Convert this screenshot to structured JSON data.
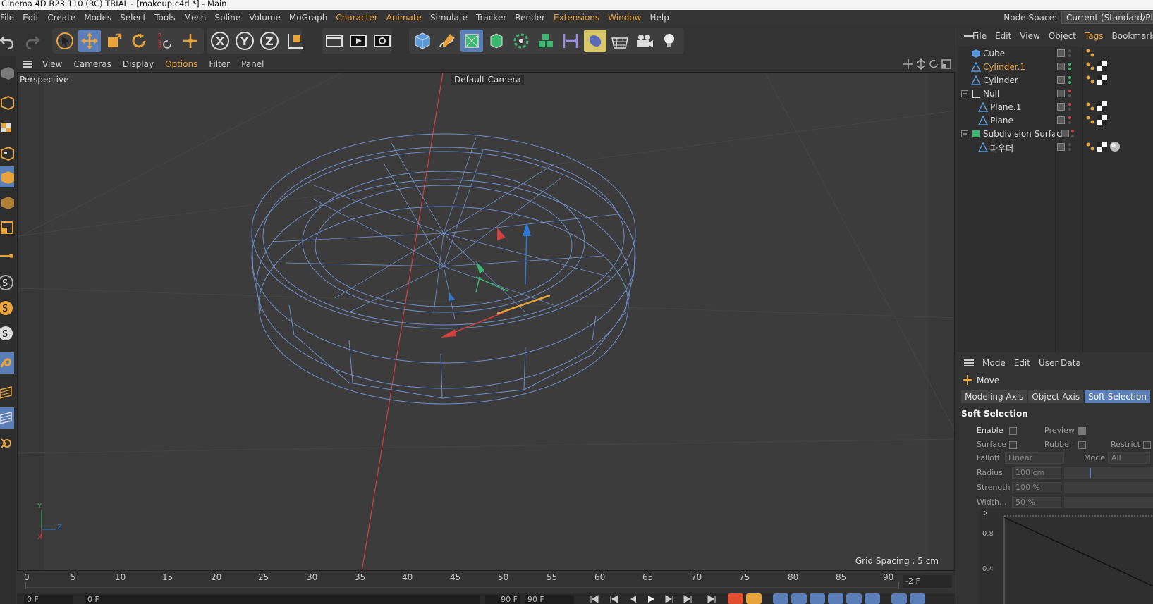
{
  "title": "Cinema 4D R23.110 (RC) TRIAL - [makeup.c4d *] - Main",
  "menu": [
    "File",
    "Edit",
    "Create",
    "Modes",
    "Select",
    "Tools",
    "Mesh",
    "Spline",
    "Volume",
    "MoGraph",
    "Character",
    "Animate",
    "Simulate",
    "Tracker",
    "Render",
    "Extensions",
    "Window",
    "Help"
  ],
  "node_space": {
    "label": "Node Space:",
    "value": "Current (Standard/Physical)"
  },
  "viewport": {
    "menu": [
      "View",
      "Cameras",
      "Display",
      "Options",
      "Filter",
      "Panel"
    ],
    "label": "Perspective",
    "camera": "Default Camera",
    "grid_spacing": "Grid Spacing : 5 cm",
    "axis_y": "Y",
    "axis_z": "Z",
    "axis_x": "X"
  },
  "timeline": {
    "ticks": [
      "0",
      "5",
      "10",
      "15",
      "20",
      "25",
      "30",
      "35",
      "40",
      "45",
      "50",
      "55",
      "60",
      "65",
      "70",
      "75",
      "80",
      "85",
      "90"
    ],
    "frame_end": "-2 F",
    "field_start": "0 F",
    "field_current": "0 F",
    "field_max": "90 F",
    "field_max2": "90 F"
  },
  "object_manager": {
    "menu": [
      "File",
      "Edit",
      "View",
      "Object",
      "Tags",
      "Bookmarks"
    ],
    "objects": [
      {
        "name": "Cube",
        "selected": false
      },
      {
        "name": "Cylinder.1",
        "selected": true
      },
      {
        "name": "Cylinder",
        "selected": false
      },
      {
        "name": "Null",
        "selected": false
      },
      {
        "name": "Plane.1",
        "selected": false
      },
      {
        "name": "Plane",
        "selected": false
      },
      {
        "name": "Subdivision Surface",
        "selected": false
      },
      {
        "name": "파우더",
        "selected": false
      }
    ]
  },
  "attribute_manager": {
    "menu": [
      "Mode",
      "Edit",
      "User Data"
    ],
    "tool": "Move",
    "tabs": [
      "Modeling Axis",
      "Object Axis",
      "Soft Selection"
    ],
    "section": "Soft Selection",
    "enable": "Enable",
    "preview": "Preview",
    "surface": "Surface",
    "rubber": "Rubber",
    "restrict": "Restrict",
    "falloff": "Falloff",
    "falloff_value": "Linear",
    "mode": "Mode",
    "mode_value": "All",
    "radius": "Radius",
    "radius_value": "100 cm",
    "strength": "Strength",
    "strength_value": "100 %",
    "width": "Width. .",
    "width_value": "50 %",
    "curve_y1": "0.8",
    "curve_y2": "0.4"
  },
  "colors": {
    "accent": "#e8a33b",
    "selection": "#5a7fb8",
    "wireframe": "#6f8ec6"
  }
}
